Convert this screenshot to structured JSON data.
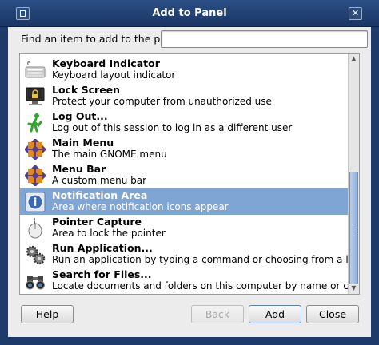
{
  "window": {
    "title": "Add to Panel"
  },
  "find": {
    "label": "Find an item to add to the panel:",
    "value": ""
  },
  "items": [
    {
      "name": "Keyboard Indicator",
      "description": "Keyboard layout indicator",
      "icon": "keyboard-icon",
      "selected": false
    },
    {
      "name": "Lock Screen",
      "description": "Protect your computer from unauthorized use",
      "icon": "lock-screen-icon",
      "selected": false
    },
    {
      "name": "Log Out...",
      "description": "Log out of this session to log in as a different user",
      "icon": "log-out-icon",
      "selected": false
    },
    {
      "name": "Main Menu",
      "description": "The main GNOME menu",
      "icon": "gnome-logo-icon",
      "selected": false
    },
    {
      "name": "Menu Bar",
      "description": "A custom menu bar",
      "icon": "gnome-logo-icon",
      "selected": false
    },
    {
      "name": "Notification Area",
      "description": "Area where notification icons appear",
      "icon": "info-icon",
      "selected": true
    },
    {
      "name": "Pointer Capture",
      "description": "Area to lock the pointer",
      "icon": "mouse-icon",
      "selected": false
    },
    {
      "name": "Run Application...",
      "description": "Run an application by typing a command or choosing from a list",
      "icon": "gears-icon",
      "selected": false
    },
    {
      "name": "Search for Files...",
      "description": "Locate documents and folders on this computer by name or content",
      "icon": "binoculars-icon",
      "selected": false
    }
  ],
  "buttons": {
    "help": "Help",
    "back": "Back",
    "add": "Add",
    "close": "Close"
  },
  "colors": {
    "selection": "#7ea5d4",
    "titlebar": "#1d3a6b",
    "gnome_purple": "#5a3d8a",
    "gnome_orange": "#e08a1e"
  }
}
